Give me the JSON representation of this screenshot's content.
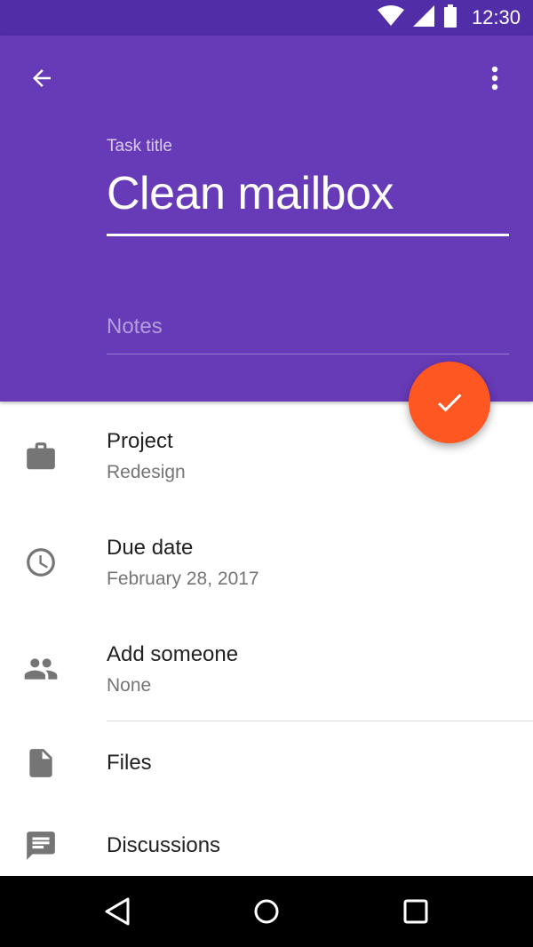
{
  "status_bar": {
    "time": "12:30",
    "icons": [
      "wifi-icon",
      "signal-icon",
      "battery-icon"
    ]
  },
  "header": {
    "title_label": "Task title",
    "title_value": "Clean mailbox",
    "notes_placeholder": "Notes",
    "icons": {
      "back": "arrow-back-icon",
      "menu": "more-vert-icon"
    }
  },
  "fab": {
    "icon": "check-icon"
  },
  "details": [
    {
      "icon": "briefcase-icon",
      "title": "Project",
      "value": "Redesign"
    },
    {
      "icon": "clock-icon",
      "title": "Due date",
      "value": "February 28, 2017"
    },
    {
      "icon": "people-icon",
      "title": "Add someone",
      "value": "None"
    },
    {
      "icon": "file-icon",
      "title": "Files"
    },
    {
      "icon": "chat-icon",
      "title": "Discussions"
    }
  ],
  "nav_bar": {
    "icons": [
      "back-nav-icon",
      "home-nav-icon",
      "recents-nav-icon"
    ]
  },
  "colors": {
    "primary_dark": "#512da8",
    "primary": "#673ab7",
    "accent": "#ff5722",
    "icon_grey": "#757575"
  }
}
